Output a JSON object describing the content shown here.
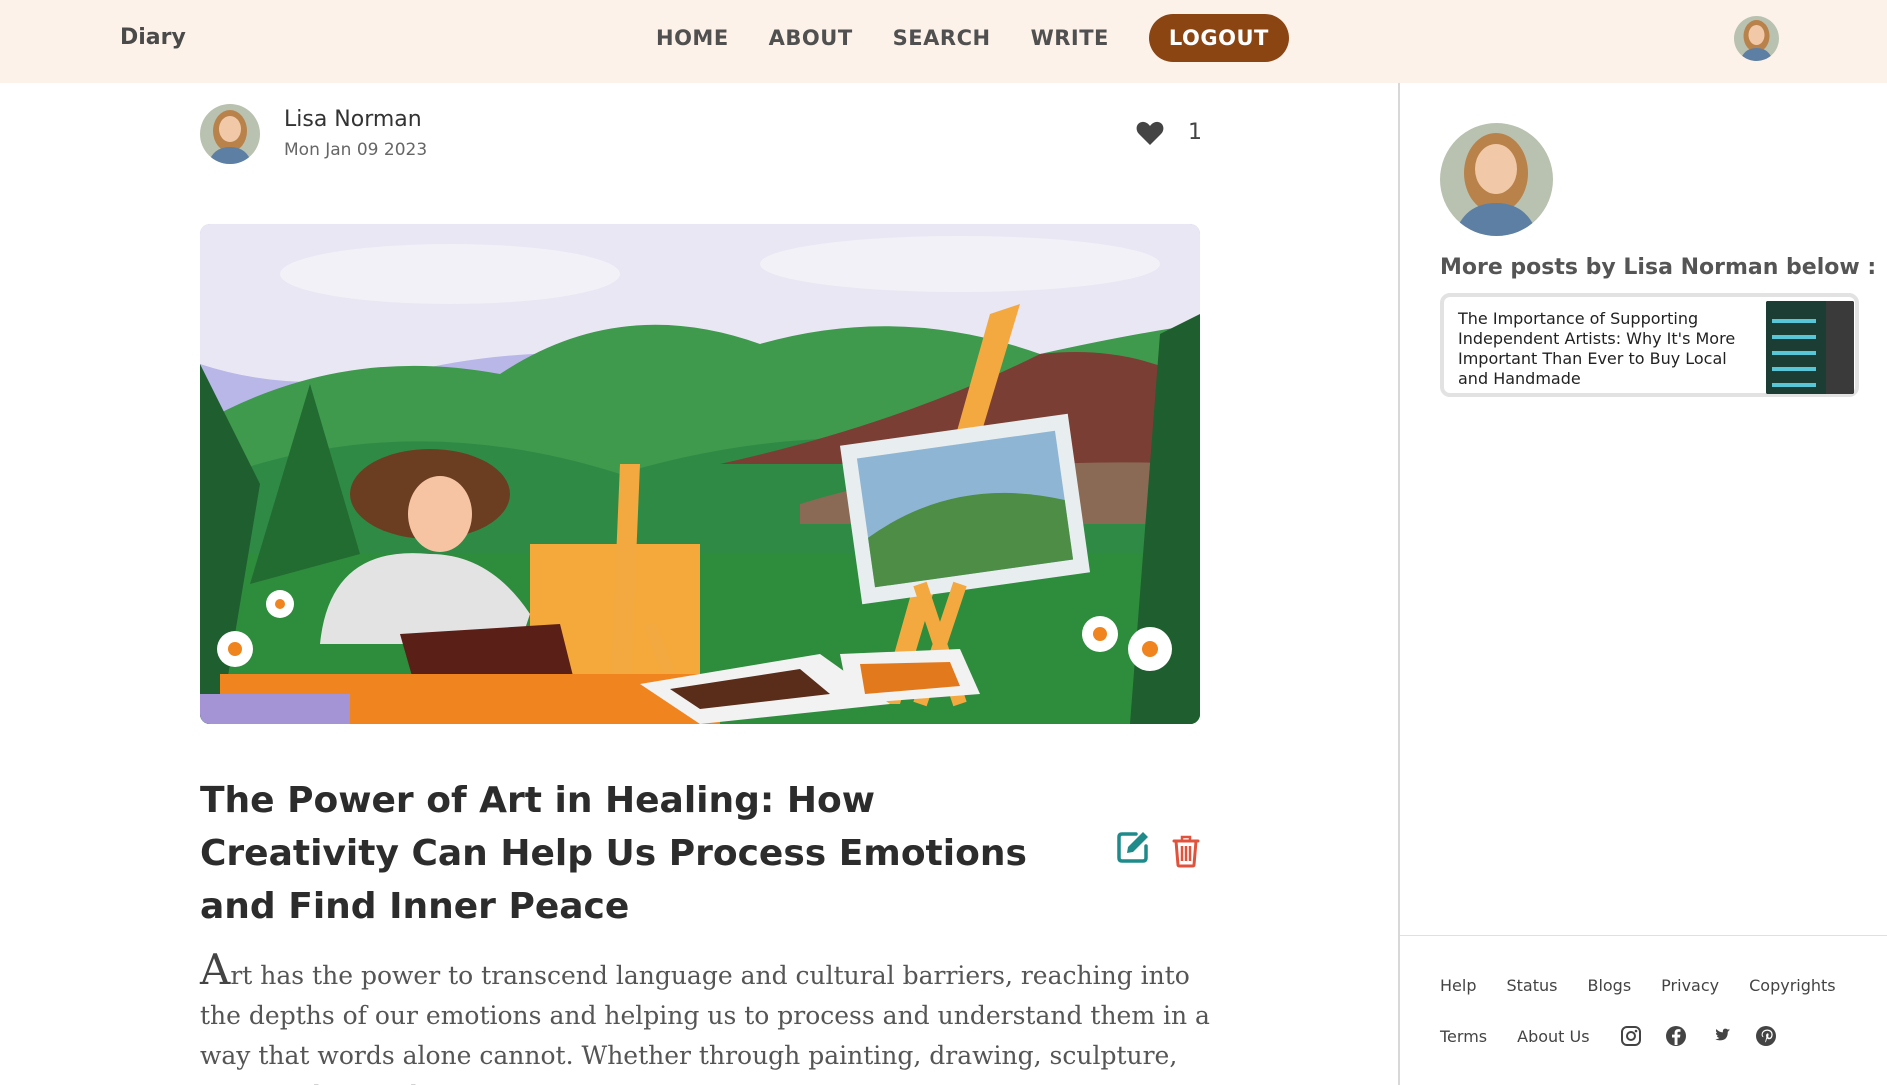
{
  "header": {
    "brand": "Diary",
    "nav": [
      "HOME",
      "ABOUT",
      "SEARCH",
      "WRITE"
    ],
    "logout_label": "LOGOUT"
  },
  "post": {
    "author": "Lisa Norman",
    "date": "Mon Jan 09 2023",
    "likes": "1",
    "title": "The Power of Art in Healing: How Creativity Can Help Us Process Emotions and Find Inner Peace",
    "body_dropcap": "A",
    "body_rest": "rt has the power to transcend language and cultural barriers, reaching into the depths of our emotions and helping us to process and understand them in a way that words alone cannot. Whether through painting, drawing, sculpture, or any other medium, creating art"
  },
  "sidebar": {
    "more_heading": "More posts by Lisa Norman below :",
    "more_posts": [
      {
        "title": "The Importance of Supporting Independent Artists: Why It's More Important Than Ever to Buy Local and Handmade"
      }
    ]
  },
  "footer": {
    "row1": [
      "Help",
      "Status",
      "Blogs",
      "Privacy",
      "Copyrights"
    ],
    "row2": [
      "Terms",
      "About Us"
    ],
    "social_icons": [
      "instagram-icon",
      "facebook-icon",
      "twitter-icon",
      "pinterest-icon"
    ]
  },
  "colors": {
    "header_bg": "#fcf2ea",
    "logout_bg": "#8b4513",
    "edit_icon": "#1f8a8a",
    "delete_icon": "#e0523c"
  }
}
